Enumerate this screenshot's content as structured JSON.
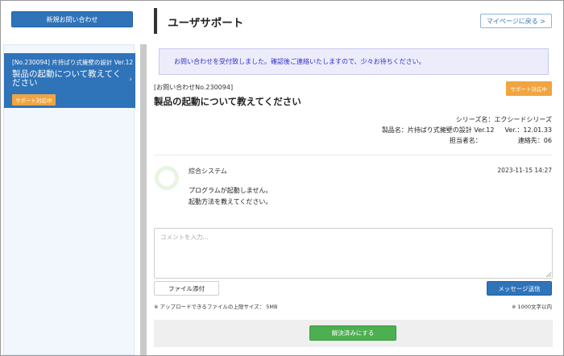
{
  "sidebar": {
    "new_button": "新規お問い合わせ",
    "items": [
      {
        "number": "[No.230094] 片持ばり式擁壁の設計 Ver.12",
        "title": "製品の起動について教えてください",
        "status": "サポート対応中"
      }
    ]
  },
  "main": {
    "title": "ユーザサポート",
    "mypage_button": "マイページに戻る >",
    "notice": "お問い合わせを受付致しました。確認後ご連絡いたしますので、少々お待ちください。",
    "inquiry": {
      "number": "[お問い合わせNo.230094]",
      "title": "製品の起動について教えてください",
      "status_badge": "サポート対応中",
      "series": "シリーズ名：エクシードシリーズ",
      "product": "製品名：片持ばり式擁壁の設計 Ver.12",
      "version": "Ver.：12.01.33",
      "person_label": "担当者名：",
      "contact": "連絡先：06"
    },
    "message": {
      "author": "綜合システム",
      "timestamp": "2023-11-15 14:27",
      "line1": "プログラムが起動しません。",
      "line2": "起動方法を教えてください。"
    },
    "comment": {
      "placeholder": "コメントを入力...",
      "value": ""
    },
    "file_button": "ファイル添付",
    "send_button": "メッセージ送信",
    "upload_note": "※ アップロードできるファイルの上限サイズ： 5MB",
    "char_note": "※ 1000文字以内",
    "resolve_button": "解決済みにする"
  },
  "colors": {
    "primary": "#2f73b9",
    "badge": "#f0a540",
    "success": "#4caf50",
    "notice_bg": "#ececfb",
    "notice_text": "#3232c8"
  }
}
